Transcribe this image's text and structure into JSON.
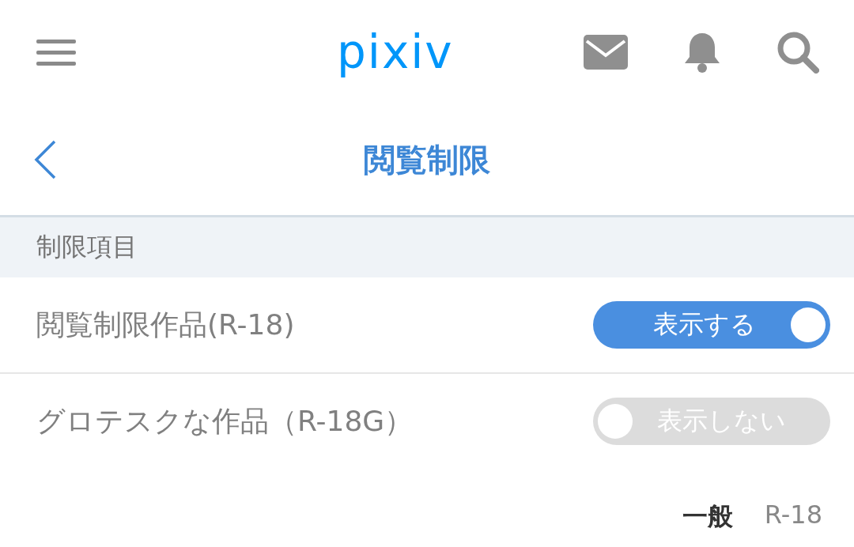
{
  "header": {
    "logo": "pixiv"
  },
  "page": {
    "title": "閲覧制限"
  },
  "section": {
    "title": "制限項目"
  },
  "settings": [
    {
      "label": "閲覧制限作品(R-18)",
      "on": true,
      "state_text": "表示する"
    },
    {
      "label": "グロテスクな作品（R-18G）",
      "on": false,
      "state_text": "表示しない"
    }
  ],
  "tabs": [
    {
      "label": "一般",
      "selected": true
    },
    {
      "label": "R-18",
      "selected": false
    }
  ]
}
